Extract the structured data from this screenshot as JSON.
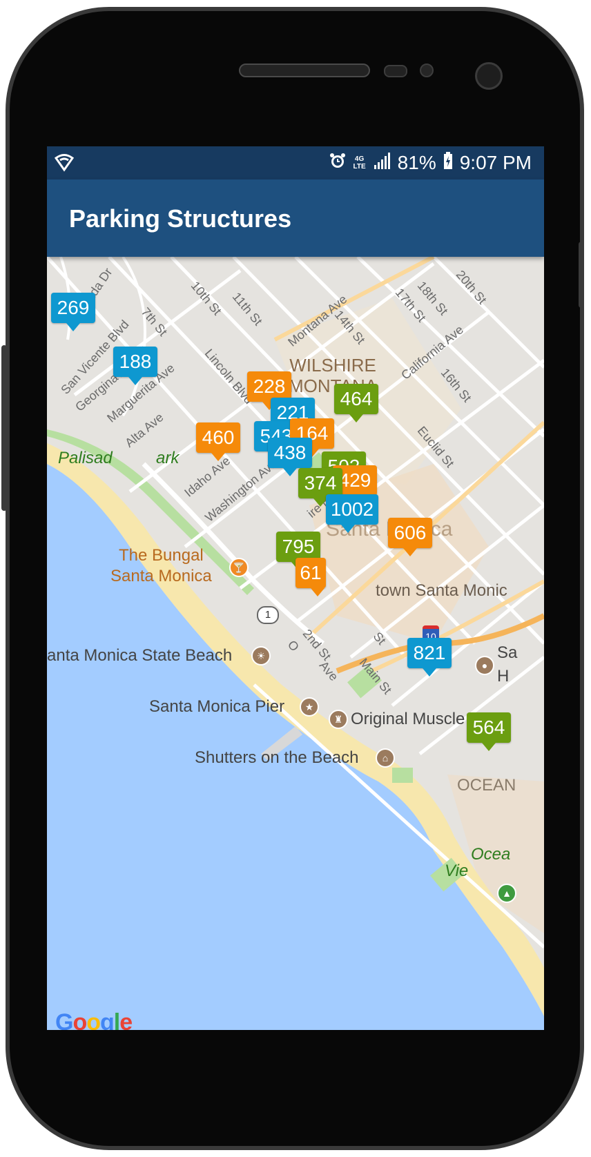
{
  "status_bar": {
    "battery": "81%",
    "time": "9:07 PM",
    "network": "4G LTE"
  },
  "app_bar": {
    "title": "Parking Structures"
  },
  "colors": {
    "app_bar": "#1e507f",
    "status_bar": "#173a60",
    "water": "#a3ccff",
    "beach": "#f7e7ad",
    "land": "#e5e3df",
    "marker_blue": "#0e98d0",
    "marker_orange": "#f58a0a",
    "marker_green": "#6b9e10"
  },
  "map": {
    "districts": {
      "wilshire": "WILSHIRE\nMONTANA",
      "santa_monica": "Santa Monica",
      "downtown": "town Santa Monic",
      "ocean": "OCEAN"
    },
    "places": {
      "bungalow": "The Bungal\nSanta Monica",
      "state_beach": "anta Monica State Beach",
      "pier": "Santa Monica Pier",
      "muscle_beach": "Original Muscle Beac",
      "shutters": "Shutters on the Beach",
      "palisades": "Palisad",
      "palisades_end": "ark",
      "ocean_view": "Ocea",
      "ocean_view2": "Vie",
      "sa": "Sa",
      "h": "H"
    },
    "streets": {
      "entrada": "Entrada Dr",
      "san_vicente": "San Vicente Blvd",
      "georgina": "Georgina Ave",
      "marguerita": "Marguerita Ave",
      "alta": "Alta Ave",
      "seventh": "7th St",
      "tenth": "10th St",
      "eleventh": "11th St",
      "lincoln": "Lincoln Blvd",
      "montana": "Montana Ave",
      "fourteenth": "14th St",
      "seventeenth": "17th St",
      "eighteenth": "18th St",
      "california": "California Ave",
      "twentieth": "20th St",
      "sixteenth": "16th St",
      "euclid": "Euclid St",
      "idaho": "Idaho Ave",
      "washington": "Washington Ave",
      "wilshire_blvd": "ire Blvd",
      "second": "2nd St",
      "main": "Main St",
      "ocean_ave": "Ave",
      "o": "O",
      "st": "St"
    },
    "route_shields": {
      "highway_1": "1",
      "i10": "10"
    },
    "markers": [
      {
        "label": "269",
        "color": "blue"
      },
      {
        "label": "188",
        "color": "blue"
      },
      {
        "label": "228",
        "color": "orange"
      },
      {
        "label": "464",
        "color": "green"
      },
      {
        "label": "221",
        "color": "blue"
      },
      {
        "label": "460",
        "color": "orange"
      },
      {
        "label": "543",
        "color": "blue"
      },
      {
        "label": "164",
        "color": "orange"
      },
      {
        "label": "438",
        "color": "blue"
      },
      {
        "label": "502",
        "color": "green"
      },
      {
        "label": "374",
        "color": "green"
      },
      {
        "label": "429",
        "color": "orange"
      },
      {
        "label": "1002",
        "color": "blue"
      },
      {
        "label": "606",
        "color": "orange"
      },
      {
        "label": "795",
        "color": "green"
      },
      {
        "label": "61",
        "color": "orange"
      },
      {
        "label": "821",
        "color": "blue"
      },
      {
        "label": "564",
        "color": "green"
      }
    ],
    "attribution": "Google"
  }
}
